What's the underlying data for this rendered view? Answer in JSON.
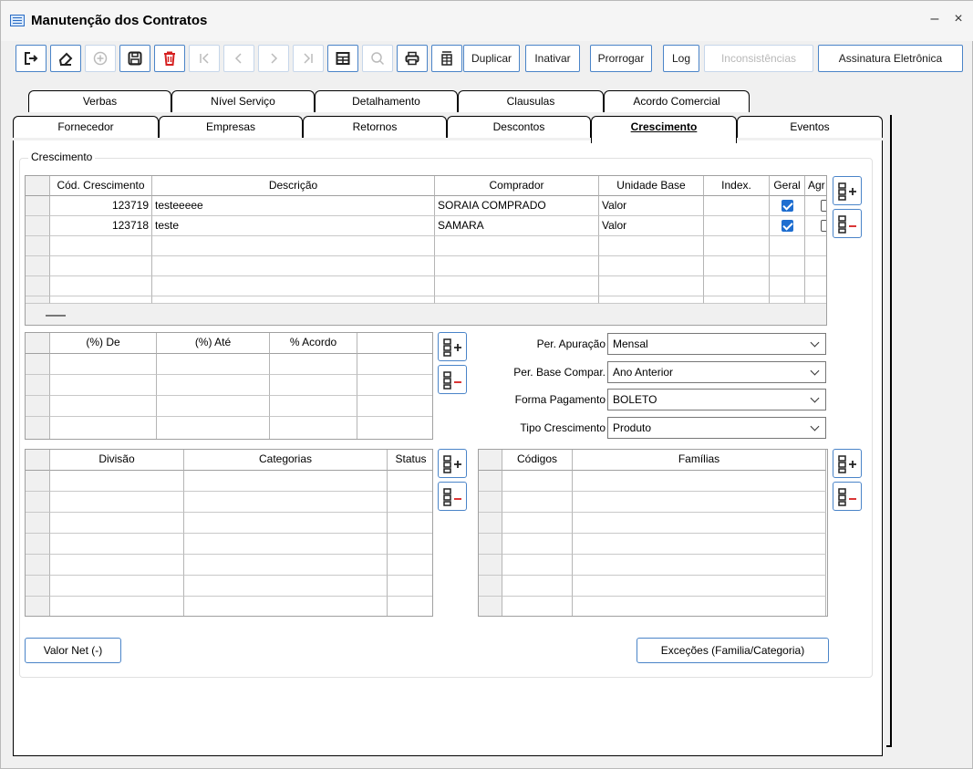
{
  "window": {
    "title": "Manutenção dos Contratos",
    "minimize": "–",
    "close": "×"
  },
  "toolbar": {
    "duplicar": "Duplicar",
    "inativar": "Inativar",
    "prorrogar": "Prorrogar",
    "log": "Log",
    "inconsistencias": "Inconsistências",
    "assinatura": "Assinatura Eletrônica"
  },
  "tabs_row1": [
    "Verbas",
    "Nível Serviço",
    "Detalhamento",
    "Clausulas",
    "Acordo Comercial"
  ],
  "tabs_row2": [
    "Fornecedor",
    "Empresas",
    "Retornos",
    "Descontos",
    "Crescimento",
    "Eventos"
  ],
  "group_label": "Crescimento",
  "grid_main": {
    "headers": [
      "Cód. Crescimento",
      "Descrição",
      "Comprador",
      "Unidade Base",
      "Index.",
      "Geral",
      "Agr"
    ],
    "rows": [
      {
        "codigo": "123719",
        "descricao": "testeeeee",
        "comprador": "SORAIA COMPRADO",
        "unidade": "Valor",
        "index": "",
        "geral": true
      },
      {
        "codigo": "123718",
        "descricao": "teste",
        "comprador": "SAMARA",
        "unidade": "Valor",
        "index": "",
        "geral": true
      }
    ]
  },
  "grid_faixas": {
    "headers": [
      "(%) De",
      "(%) Até",
      "% Acordo"
    ]
  },
  "form": {
    "per_apuracao_label": "Per. Apuração",
    "per_apuracao_value": "Mensal",
    "per_base_label": "Per. Base Compar.",
    "per_base_value": "Ano Anterior",
    "forma_pagamento_label": "Forma Pagamento",
    "forma_pagamento_value": "BOLETO",
    "tipo_crescimento_label": "Tipo Crescimento",
    "tipo_crescimento_value": "Produto"
  },
  "grid_divisao": {
    "headers": [
      "Divisão",
      "Categorias",
      "Status"
    ]
  },
  "grid_codigos": {
    "headers": [
      "Códigos",
      "Famílias"
    ]
  },
  "buttons": {
    "valor_net": "Valor Net (-)",
    "excecoes": "Exceções (Familia/Categoria)"
  },
  "colors": {
    "accent": "#4a84c8",
    "check": "#1e6ed0",
    "delete": "#d62020"
  }
}
